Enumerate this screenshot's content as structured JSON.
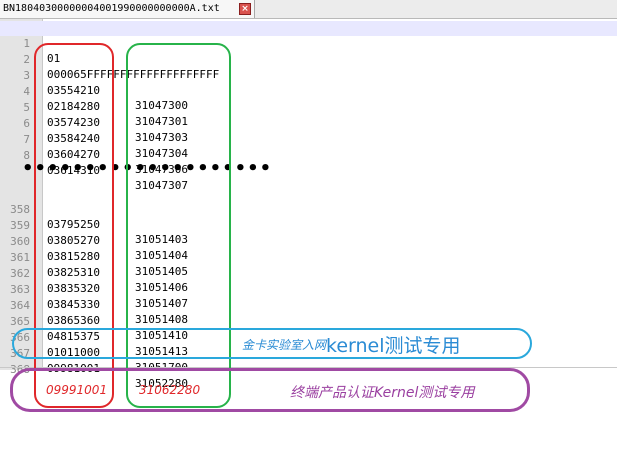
{
  "tab": {
    "title": "BN18040300000004001990000000000A.txt",
    "close": "×"
  },
  "rows": [
    {
      "ln": "1",
      "c1": "01",
      "c2": ""
    },
    {
      "ln": "2",
      "c1": "000065FFFFFFFFFFFFFFFFFFFF",
      "c2": ""
    },
    {
      "ln": "3",
      "c1": "03554210",
      "c2": "31047300"
    },
    {
      "ln": "4",
      "c1": "02184280",
      "c2": "31047301"
    },
    {
      "ln": "5",
      "c1": "03574230",
      "c2": "31047303"
    },
    {
      "ln": "6",
      "c1": "03584240",
      "c2": "31047304"
    },
    {
      "ln": "7",
      "c1": "03604270",
      "c2": "31047306"
    },
    {
      "ln": "8",
      "c1": "03614310",
      "c2": "31047307"
    },
    {
      "ln": "358",
      "c1": "03795250",
      "c2": "31051403"
    },
    {
      "ln": "359",
      "c1": "03805270",
      "c2": "31051404"
    },
    {
      "ln": "360",
      "c1": "03815280",
      "c2": "31051405"
    },
    {
      "ln": "361",
      "c1": "03825310",
      "c2": "31051406"
    },
    {
      "ln": "362",
      "c1": "03835320",
      "c2": "31051407"
    },
    {
      "ln": "363",
      "c1": "03845330",
      "c2": "31051408"
    },
    {
      "ln": "364",
      "c1": "03865360",
      "c2": "31051410"
    },
    {
      "ln": "365",
      "c1": "04815375",
      "c2": "31051413"
    },
    {
      "ln": "366",
      "c1": "01011000",
      "c2": "31051700"
    },
    {
      "ln": "367",
      "c1": "09981001",
      "c2": "31052280"
    },
    {
      "ln": "368",
      "c1": "",
      "c2": ""
    }
  ],
  "ellipsis": "••••••••••••••••••••",
  "annotations": {
    "blue_small": "金卡实验室入网",
    "blue_big": "kernel测试专用",
    "red_value": "09991001",
    "green_value": "31062280",
    "purple_text": "终端产品认证Kernel测试专用"
  },
  "colors": {
    "red": "#e0272a",
    "green": "#27b34a",
    "blue": "#2aa8dc",
    "purple": "#a04aa3"
  }
}
